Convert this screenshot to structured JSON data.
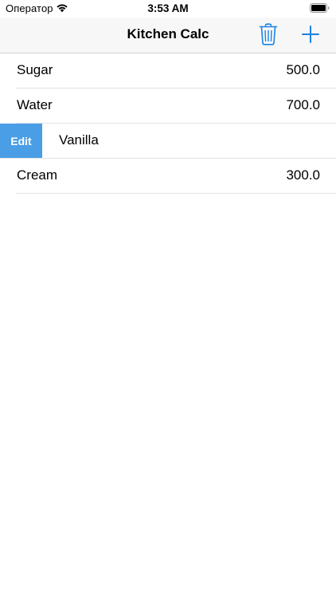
{
  "status_bar": {
    "carrier": "Оператор",
    "time": "3:53 AM",
    "wifi_icon": "wifi-icon",
    "battery_icon": "battery-icon"
  },
  "nav": {
    "title": "Kitchen Calc",
    "trash_icon": "trash-icon",
    "add_icon": "plus-icon",
    "accent_color": "#1a82e2"
  },
  "items": [
    {
      "name": "Sugar",
      "value": "500.0"
    },
    {
      "name": "Water",
      "value": "700.0"
    },
    {
      "name": "Vanilla",
      "value": "",
      "swipe_action": "Edit",
      "swipe_color": "#4a9ee5"
    },
    {
      "name": "Cream",
      "value": "300.0"
    }
  ]
}
